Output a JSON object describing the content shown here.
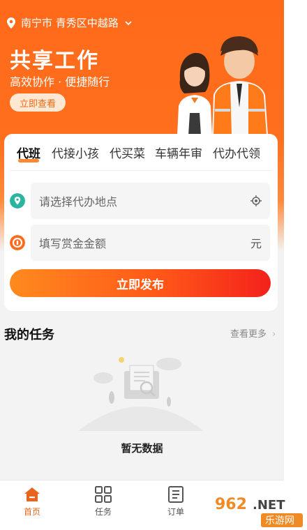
{
  "header": {
    "location": "南宁市 青秀区中越路",
    "title": "共享工作",
    "subtitle": "高效协作 · 便捷随行",
    "cta_label": "立即查看"
  },
  "service_tabs": [
    "代班",
    "代接小孩",
    "代买菜",
    "车辆年审",
    "代办代领"
  ],
  "active_tab": "代班",
  "form": {
    "location_placeholder": "请选择代办地点",
    "amount_placeholder": "填写赏金金额",
    "amount_unit": "元",
    "submit_label": "立即发布"
  },
  "tasks": {
    "title": "我的任务",
    "more_label": "查看更多",
    "empty_text": "暂无数据"
  },
  "tabbar": [
    {
      "label": "首页",
      "icon": "home-icon",
      "active": true
    },
    {
      "label": "任务",
      "icon": "grid-icon",
      "active": false
    },
    {
      "label": "订单",
      "icon": "document-icon",
      "active": false
    }
  ],
  "watermark": {
    "text1": "962",
    "text2": ".NET",
    "text3": "乐游网"
  },
  "colors": {
    "accent": "#ff6a1a",
    "button_end": "#f3221c",
    "tab_active": "#e8641c"
  }
}
